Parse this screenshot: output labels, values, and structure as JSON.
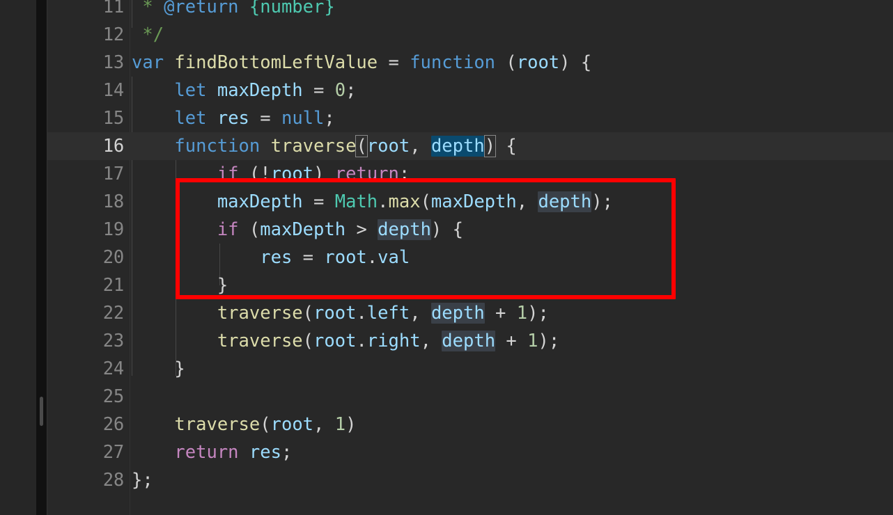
{
  "editor": {
    "language": "javascript",
    "theme": "dark-plus",
    "active_line": 16,
    "line_height_px": 40,
    "first_visible_line": 11,
    "last_visible_line": 28
  },
  "colors": {
    "background": "#282828",
    "active_line_background": "#2f2f2f",
    "line_number": "#868686",
    "line_number_active": "#d4d4d4",
    "indent_guide": "#474747",
    "selection_highlight": "#0a4a6e",
    "word_occurrence_highlight": "#3a4048",
    "bracket_match_border": "#888888",
    "annotation_red": "#ff0000",
    "keyword": "#c586c0",
    "declaration": "#569cd6",
    "function_name": "#dcdcaa",
    "variable": "#9cdcfe",
    "number": "#b5cea8",
    "class_name": "#4ec9b0",
    "punctuation": "#d4d4d4",
    "comment": "#6a9955"
  },
  "annotation": {
    "type": "rectangle-highlight",
    "covers_lines": [
      18,
      19,
      20,
      21
    ],
    "color": "#ff0000",
    "border_width_px": 6
  },
  "lines": [
    {
      "number": "11",
      "text": " * @return {number}"
    },
    {
      "number": "12",
      "text": " */"
    },
    {
      "number": "13",
      "text": "var findBottomLeftValue = function (root) {"
    },
    {
      "number": "14",
      "text": "    let maxDepth = 0;"
    },
    {
      "number": "15",
      "text": "    let res = null;"
    },
    {
      "number": "16",
      "text": "    function traverse(root, depth) {"
    },
    {
      "number": "17",
      "text": "        if (!root) return;"
    },
    {
      "number": "18",
      "text": "        maxDepth = Math.max(maxDepth, depth);"
    },
    {
      "number": "19",
      "text": "        if (maxDepth > depth) {"
    },
    {
      "number": "20",
      "text": "            res = root.val"
    },
    {
      "number": "21",
      "text": "        }"
    },
    {
      "number": "22",
      "text": "        traverse(root.left, depth + 1);"
    },
    {
      "number": "23",
      "text": "        traverse(root.right, depth + 1);"
    },
    {
      "number": "24",
      "text": "    }"
    },
    {
      "number": "25",
      "text": ""
    },
    {
      "number": "26",
      "text": "    traverse(root, 1)"
    },
    {
      "number": "27",
      "text": "    return res;"
    },
    {
      "number": "28",
      "text": "};"
    }
  ],
  "line_numbers": {
    "n11": "11",
    "n12": "12",
    "n13": "13",
    "n14": "14",
    "n15": "15",
    "n16": "16",
    "n17": "17",
    "n18": "18",
    "n19": "19",
    "n20": "20",
    "n21": "21",
    "n22": "22",
    "n23": "23",
    "n24": "24",
    "n25": "25",
    "n26": "26",
    "n27": "27",
    "n28": "28"
  },
  "tokens": {
    "l11": {
      "star": " * ",
      "tag": "@return",
      "space": " ",
      "type": "{number}"
    },
    "l12": {
      "close": " */"
    },
    "l13": {
      "var": "var",
      "sp1": " ",
      "name": "findBottomLeftValue",
      "sp2": " ",
      "eq": "= ",
      "function": "function",
      "sp3": " ",
      "paren_open": "(",
      "root": "root",
      "paren_close": ")",
      "brace": " {"
    },
    "l14": {
      "indent": "    ",
      "let": "let",
      "sp1": " ",
      "name": "maxDepth",
      "eq": " = ",
      "num": "0",
      "semi": ";"
    },
    "l15": {
      "indent": "    ",
      "let": "let",
      "sp1": " ",
      "name": "res",
      "eq": " = ",
      "null": "null",
      "semi": ";"
    },
    "l16": {
      "indent": "    ",
      "function": "function",
      "sp1": " ",
      "name": "traverse",
      "paren_open": "(",
      "root": "root",
      "comma": ", ",
      "depth": "depth",
      "paren_close": ")",
      "brace": " {"
    },
    "l17": {
      "indent": "        ",
      "if": "if",
      "sp1": " ",
      "paren_open": "(",
      "bang": "!",
      "root": "root",
      "paren_close": ") ",
      "return": "return",
      "semi": ";"
    },
    "l18": {
      "indent": "        ",
      "maxdepth": "maxDepth",
      "eq": " = ",
      "math": "Math",
      "dot": ".",
      "max": "max",
      "paren_open": "(",
      "arg1": "maxDepth",
      "comma": ", ",
      "depth": "depth",
      "paren_close": ")",
      "semi": ";"
    },
    "l19": {
      "indent": "        ",
      "if": "if",
      "sp1": " ",
      "paren_open": "(",
      "maxdepth": "maxDepth",
      "gt": " > ",
      "depth": "depth",
      "paren_close": ")",
      "brace": " {"
    },
    "l20": {
      "indent": "            ",
      "res": "res",
      "eq": " = ",
      "root": "root",
      "dot": ".",
      "val": "val"
    },
    "l21": {
      "indent": "        ",
      "brace": "}"
    },
    "l22": {
      "indent": "        ",
      "fn": "traverse",
      "paren_open": "(",
      "root": "root",
      "dot": ".",
      "left": "left",
      "comma": ", ",
      "depth": "depth",
      "plus": " + ",
      "num": "1",
      "paren_close": ")",
      "semi": ";"
    },
    "l23": {
      "indent": "        ",
      "fn": "traverse",
      "paren_open": "(",
      "root": "root",
      "dot": ".",
      "right": "right",
      "comma": ", ",
      "depth": "depth",
      "plus": " + ",
      "num": "1",
      "paren_close": ")",
      "semi": ";"
    },
    "l24": {
      "indent": "    ",
      "brace": "}"
    },
    "l26": {
      "indent": "    ",
      "fn": "traverse",
      "paren_open": "(",
      "root": "root",
      "comma": ", ",
      "num": "1",
      "paren_close": ")"
    },
    "l27": {
      "indent": "    ",
      "return": "return",
      "sp1": " ",
      "res": "res",
      "semi": ";"
    },
    "l28": {
      "brace": "};"
    }
  }
}
